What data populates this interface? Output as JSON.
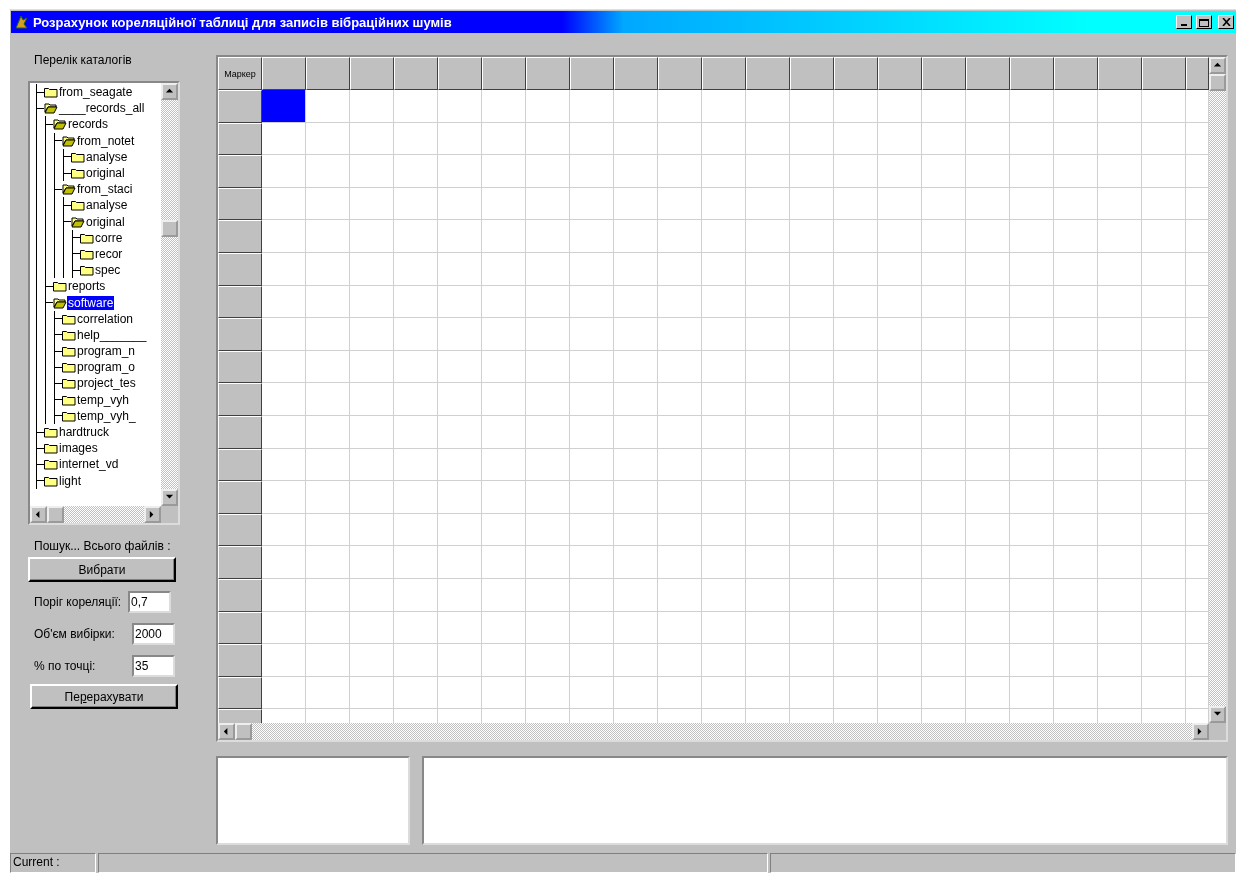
{
  "window": {
    "title": "Розрахунок кореляційної таблиці для записів вібраційних шумів"
  },
  "catalog_label": "Перелік каталогів",
  "tree": [
    {
      "label": "from_seagate",
      "expanded": false,
      "selected": false
    },
    {
      "label": "____records_all",
      "expanded": true,
      "selected": false,
      "children": [
        {
          "label": "records",
          "expanded": true,
          "selected": false,
          "children": [
            {
              "label": "from_notet",
              "expanded": true,
              "selected": false,
              "children": [
                {
                  "label": "analyse",
                  "expanded": false,
                  "selected": false
                },
                {
                  "label": "original",
                  "expanded": false,
                  "selected": false
                }
              ]
            },
            {
              "label": "from_staci",
              "expanded": true,
              "selected": false,
              "children": [
                {
                  "label": "analyse",
                  "expanded": false,
                  "selected": false
                },
                {
                  "label": "original",
                  "expanded": true,
                  "selected": false,
                  "children": [
                    {
                      "label": "corre",
                      "expanded": false,
                      "selected": false
                    },
                    {
                      "label": "recor",
                      "expanded": false,
                      "selected": false
                    },
                    {
                      "label": "spec",
                      "expanded": false,
                      "selected": false
                    }
                  ]
                }
              ]
            }
          ]
        },
        {
          "label": "reports",
          "expanded": false,
          "selected": false
        },
        {
          "label": "software",
          "expanded": true,
          "selected": true,
          "children": [
            {
              "label": "correlation",
              "expanded": false,
              "selected": false
            },
            {
              "label": "help_______",
              "expanded": false,
              "selected": false
            },
            {
              "label": "program_n",
              "expanded": false,
              "selected": false
            },
            {
              "label": "program_o",
              "expanded": false,
              "selected": false
            },
            {
              "label": "project_tes",
              "expanded": false,
              "selected": false
            },
            {
              "label": "temp_vyh",
              "expanded": false,
              "selected": false
            },
            {
              "label": "temp_vyh_",
              "expanded": false,
              "selected": false
            }
          ]
        }
      ]
    },
    {
      "label": "hardtruck",
      "expanded": false,
      "selected": false
    },
    {
      "label": "images",
      "expanded": false,
      "selected": false
    },
    {
      "label": "internet_vd",
      "expanded": false,
      "selected": false
    },
    {
      "label": "light",
      "expanded": false,
      "selected": false
    }
  ],
  "search_status": "Пошук... Всього файлів :",
  "select_button": "Вибрати",
  "fields": [
    {
      "label": "Поріг кореляції:",
      "value": "0,7"
    },
    {
      "label": "Об'єм вибірки:",
      "value": "2000"
    },
    {
      "label": "% по точці:",
      "value": "35"
    }
  ],
  "recalc_button": {
    "before": "Пе",
    "accelerator": "р",
    "after": "ерахувати"
  },
  "grid": {
    "corner": "Маркер",
    "rows": [
      {
        "selected": true
      },
      {
        "selected": false
      },
      {
        "selected": false
      },
      {
        "selected": false
      },
      {
        "selected": false
      },
      {
        "selected": false
      },
      {
        "selected": false
      },
      {
        "selected": false
      },
      {
        "selected": false
      },
      {
        "selected": false
      },
      {
        "selected": false
      },
      {
        "selected": false
      },
      {
        "selected": false
      },
      {
        "selected": false
      },
      {
        "selected": false
      },
      {
        "selected": false
      },
      {
        "selected": false
      },
      {
        "selected": false
      },
      {
        "selected": false
      },
      {
        "selected": false
      }
    ]
  },
  "status_bar": {
    "current_label": "Current :"
  }
}
